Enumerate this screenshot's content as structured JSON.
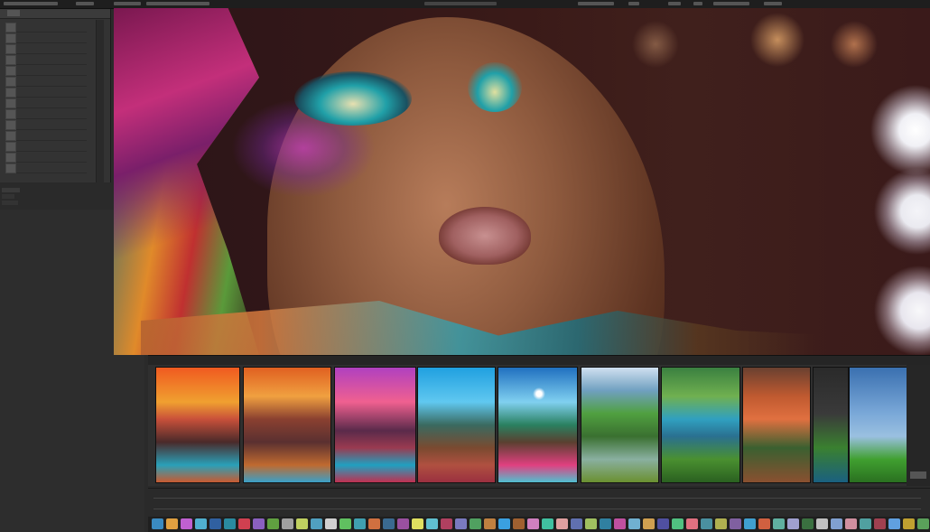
{
  "menubar": {
    "center_text": "",
    "colors": {
      "bg": "#1e1e1e"
    }
  },
  "layers_panel": {
    "tab_label": "",
    "items": [
      {
        "label": ""
      },
      {
        "label": ""
      },
      {
        "label": ""
      },
      {
        "label": ""
      },
      {
        "label": ""
      },
      {
        "label": ""
      },
      {
        "label": ""
      },
      {
        "label": ""
      },
      {
        "label": ""
      },
      {
        "label": ""
      },
      {
        "label": ""
      },
      {
        "label": ""
      },
      {
        "label": ""
      },
      {
        "label": ""
      }
    ]
  },
  "filmstrip": {
    "header_label": "",
    "thumbnails": [
      {
        "name": "sunset-mountain"
      },
      {
        "name": "orange-mountains"
      },
      {
        "name": "purple-lake"
      },
      {
        "name": "blue-sky-valley"
      },
      {
        "name": "sun-burst-valley"
      },
      {
        "name": "green-river"
      },
      {
        "name": "blue-lake-cliffs"
      },
      {
        "name": "orange-cliff"
      },
      {
        "name": "dark-grass"
      },
      {
        "name": "blue-sky-meadow"
      }
    ]
  },
  "swatch_bar": {
    "colors": [
      "#3a8ac0",
      "#e0a040",
      "#c060d0",
      "#50b0d0",
      "#3060a0",
      "#2a8aa0",
      "#d04050",
      "#8a60c0",
      "#60a040",
      "#a0a0a0",
      "#c0d060",
      "#50a0c0",
      "#d0d0d0",
      "#60c060",
      "#40a0b0",
      "#d07040",
      "#3a6a90",
      "#9a50a0",
      "#e0e060",
      "#60c0d0",
      "#b04060",
      "#7a7ac0",
      "#50a060",
      "#c08040",
      "#3aa0e0",
      "#a06030",
      "#d080c0",
      "#40c0a0",
      "#e0a0a0",
      "#6070b0",
      "#a0c060",
      "#3080a0",
      "#c050a0",
      "#70b0d0",
      "#d0a050",
      "#5050a0",
      "#50c080",
      "#e07080",
      "#4a90a0",
      "#b0b050",
      "#8060a0",
      "#40a0d0",
      "#d06040",
      "#60b0a0",
      "#a0a0d0",
      "#3a7040",
      "#c0c0c0",
      "#80a0d0",
      "#d090a0",
      "#50a0a0",
      "#a04050",
      "#60a0e0",
      "#c0a030",
      "#5aa05a"
    ]
  }
}
